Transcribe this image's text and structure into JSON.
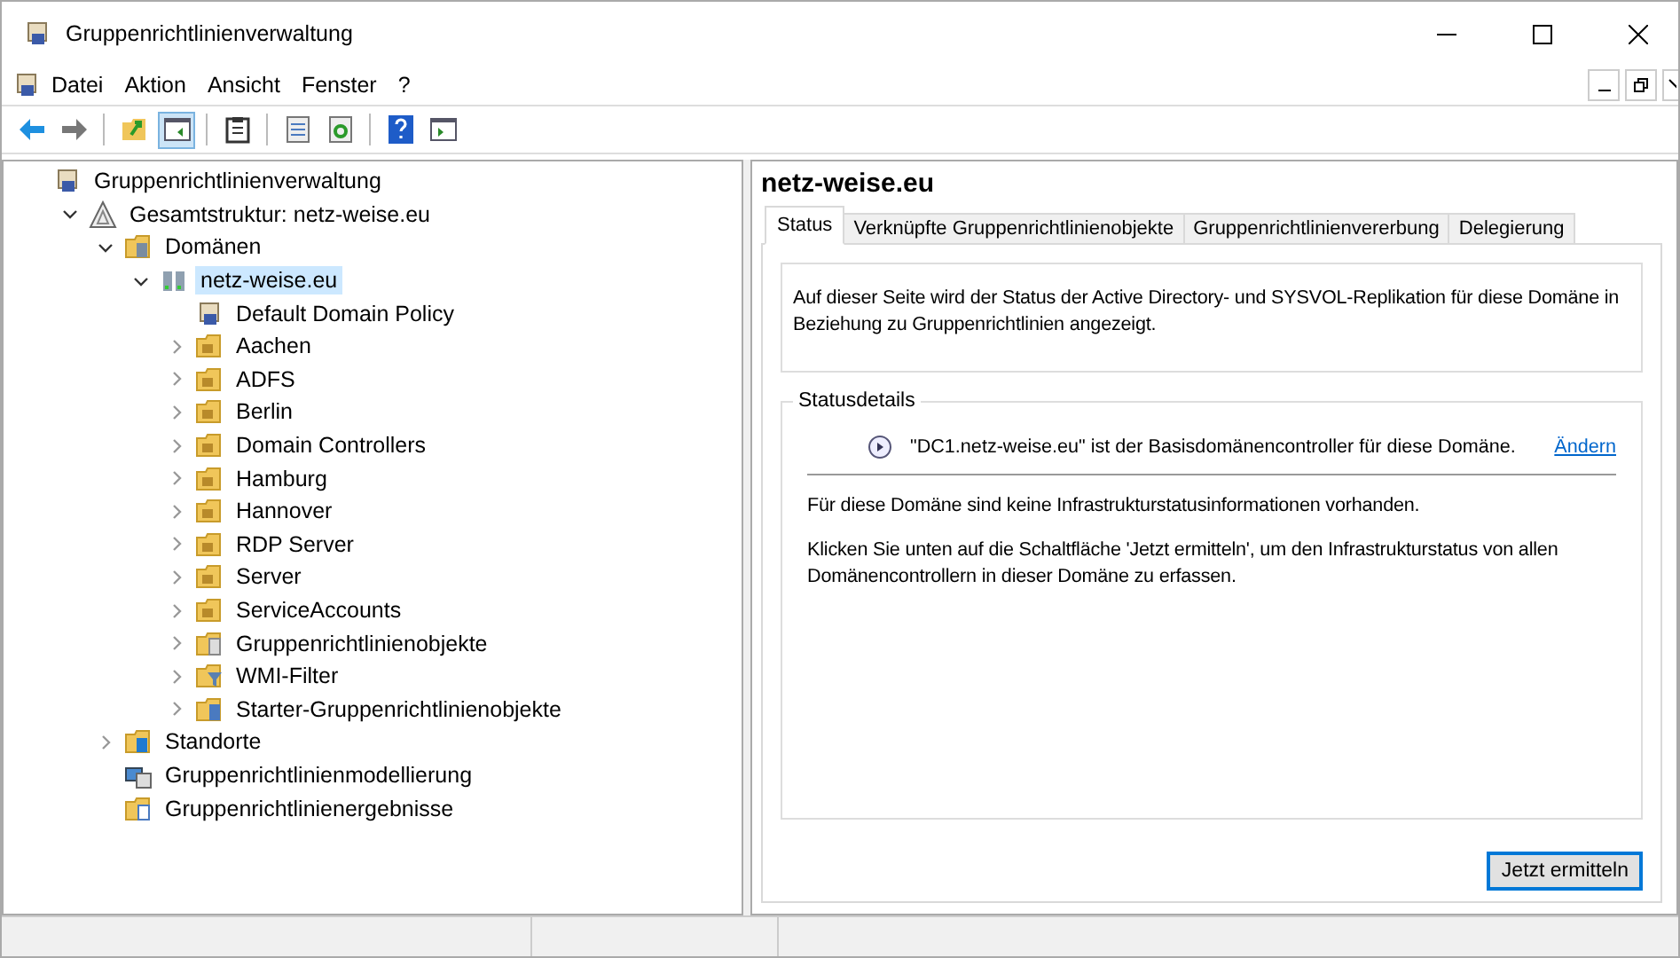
{
  "window": {
    "title": "Gruppenrichtlinienverwaltung"
  },
  "menu": [
    "Datei",
    "Aktion",
    "Ansicht",
    "Fenster",
    "?"
  ],
  "toolbar": [
    {
      "kind": "back",
      "selected": false
    },
    {
      "kind": "forward",
      "selected": false
    },
    {
      "kind": "separator"
    },
    {
      "kind": "up",
      "selected": false
    },
    {
      "kind": "tree",
      "selected": true
    },
    {
      "kind": "separator"
    },
    {
      "kind": "clipboard",
      "selected": false
    },
    {
      "kind": "separator"
    },
    {
      "kind": "properties",
      "selected": false
    },
    {
      "kind": "refresh",
      "selected": false
    },
    {
      "kind": "separator"
    },
    {
      "kind": "help",
      "selected": false
    },
    {
      "kind": "pane",
      "selected": false
    }
  ],
  "tree": [
    {
      "label": "Gruppenrichtlinienverwaltung",
      "kind": "console",
      "selected": false,
      "children": [
        {
          "label": "Gesamtstruktur: netz-weise.eu",
          "kind": "forest",
          "expanded": true,
          "selected": false,
          "children": [
            {
              "label": "Domänen",
              "kind": "domains",
              "expanded": true,
              "selected": false,
              "children": [
                {
                  "label": "netz-weise.eu",
                  "kind": "domain",
                  "expanded": true,
                  "selected": true,
                  "children": [
                    {
                      "label": "Default Domain Policy",
                      "kind": "gpo",
                      "selected": false
                    },
                    {
                      "label": "Aachen",
                      "kind": "ou",
                      "expanded": false,
                      "selected": false
                    },
                    {
                      "label": "ADFS",
                      "kind": "ou",
                      "expanded": false,
                      "selected": false
                    },
                    {
                      "label": "Berlin",
                      "kind": "ou",
                      "expanded": false,
                      "selected": false
                    },
                    {
                      "label": "Domain Controllers",
                      "kind": "ou",
                      "expanded": false,
                      "selected": false
                    },
                    {
                      "label": "Hamburg",
                      "kind": "ou",
                      "expanded": false,
                      "selected": false
                    },
                    {
                      "label": "Hannover",
                      "kind": "ou",
                      "expanded": false,
                      "selected": false
                    },
                    {
                      "label": "RDP Server",
                      "kind": "ou",
                      "expanded": false,
                      "selected": false
                    },
                    {
                      "label": "Server",
                      "kind": "ou",
                      "expanded": false,
                      "selected": false
                    },
                    {
                      "label": "ServiceAccounts",
                      "kind": "ou",
                      "expanded": false,
                      "selected": false
                    },
                    {
                      "label": "Gruppenrichtlinienobjekte",
                      "kind": "gpofolder",
                      "expanded": false,
                      "selected": false
                    },
                    {
                      "label": "WMI-Filter",
                      "kind": "wmi",
                      "expanded": false,
                      "selected": false
                    },
                    {
                      "label": "Starter-Gruppenrichtlinienobjekte",
                      "kind": "starter",
                      "expanded": false,
                      "selected": false
                    }
                  ]
                }
              ]
            },
            {
              "label": "Standorte",
              "kind": "sites",
              "expanded": false,
              "selected": false
            },
            {
              "label": "Gruppenrichtlinienmodellierung",
              "kind": "modeling",
              "selected": false
            },
            {
              "label": "Gruppenrichtlinienergebnisse",
              "kind": "results",
              "selected": false
            }
          ]
        }
      ]
    }
  ],
  "detail": {
    "title": "netz-weise.eu",
    "tabs": [
      {
        "label": "Status",
        "selected": true
      },
      {
        "label": "Verknüpfte Gruppenrichtlinienobjekte",
        "selected": false
      },
      {
        "label": "Gruppenrichtlinienvererbung",
        "selected": false
      },
      {
        "label": "Delegierung",
        "selected": false
      }
    ],
    "intro": "Auf dieser Seite wird der Status der Active Directory- und SYSVOL-Replikation für diese Domäne in Beziehung zu Gruppenrichtlinien angezeigt.",
    "group_title": "Statusdetails",
    "baseline": "\"DC1.netz-weise.eu\" ist der Basisdomänencontroller für diese Domäne.",
    "change_link": "Ändern",
    "messages": [
      "Für diese Domäne sind keine Infrastrukturstatusinformationen vorhanden.",
      "Klicken Sie unten auf die Schaltfläche 'Jetzt ermitteln', um den Infrastrukturstatus von allen Domänencontrollern in dieser Domäne zu erfassen."
    ],
    "button": "Jetzt ermitteln"
  }
}
